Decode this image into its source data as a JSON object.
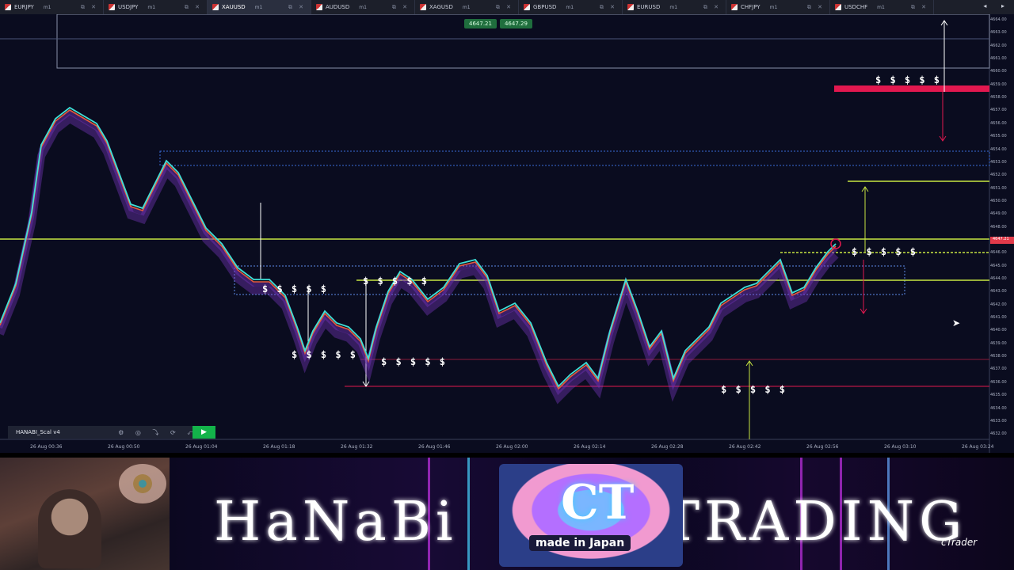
{
  "tabs": [
    {
      "symbol": "EURJPY",
      "timeframe": "m1"
    },
    {
      "symbol": "USDJPY",
      "timeframe": "m1"
    },
    {
      "symbol": "XAUUSD",
      "timeframe": "m1",
      "active": true
    },
    {
      "symbol": "AUDUSD",
      "timeframe": "m1"
    },
    {
      "symbol": "XAGUSD",
      "timeframe": "m1"
    },
    {
      "symbol": "GBPUSD",
      "timeframe": "m1"
    },
    {
      "symbol": "EURUSD",
      "timeframe": "m1"
    },
    {
      "symbol": "CHFJPY",
      "timeframe": "m1"
    },
    {
      "symbol": "USDCHF",
      "timeframe": "m1"
    }
  ],
  "tab_nav": "◂ ▸",
  "bid_badge": "4647.21",
  "ask_badge": "4647.29",
  "price_axis": [
    "4664.00",
    "4663.00",
    "4662.00",
    "4661.00",
    "4660.00",
    "4659.00",
    "4658.00",
    "4657.00",
    "4656.00",
    "4655.00",
    "4654.00",
    "4653.00",
    "4652.00",
    "4651.00",
    "4650.00",
    "4649.00",
    "4648.00",
    "4647.00",
    "4646.00",
    "4645.00",
    "4644.00",
    "4643.00",
    "4642.00",
    "4641.00",
    "4640.00",
    "4639.00",
    "4638.00",
    "4637.00",
    "4636.00",
    "4635.00",
    "4634.00",
    "4633.00",
    "4632.00"
  ],
  "current_price_tag": "4647.21",
  "time_axis": [
    "26 Aug 00:36",
    "26 Aug 00:50",
    "26 Aug 01:04",
    "26 Aug 01:18",
    "26 Aug 01:32",
    "26 Aug 01:46",
    "26 Aug 02:00",
    "26 Aug 02:14",
    "26 Aug 02:28",
    "26 Aug 02:42",
    "26 Aug 02:56",
    "26 Aug 03:10",
    "26 Aug 03:24"
  ],
  "dollar_marks": "$ $ $ $ $",
  "indicator_name": "HANABI_Scal v4",
  "indicator_icons": "⚙ ◎ ⤵ ⟳ ⤺ ✕",
  "play_icon": "▶",
  "cursor_icon": "➤",
  "banner": {
    "brand_left": "HaNaBi",
    "brand_right": "TRADING",
    "logo_text": "CT",
    "logo_label": "made in Japan",
    "ctrader_mark": "cTrader"
  },
  "colors": {
    "accent_green": "#13b34a",
    "level_red": "#e2184f",
    "level_yellow": "#c8e642",
    "chart_bg": "#0a0c1f"
  }
}
